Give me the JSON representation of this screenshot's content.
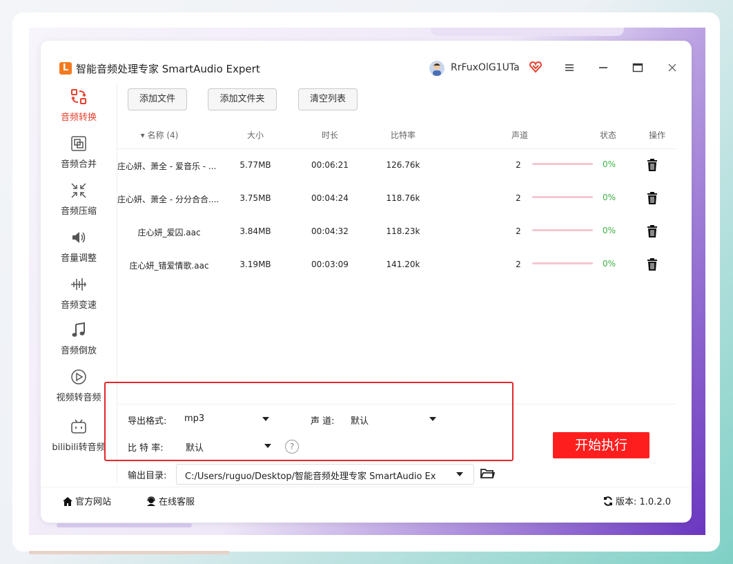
{
  "app": {
    "title": "智能音频处理专家 SmartAudio Expert",
    "logo_letter": "L"
  },
  "user": {
    "name": "RrFuxOlG1UTa"
  },
  "sidebar": {
    "items": [
      {
        "label": "音频转换",
        "icon": "convert-icon"
      },
      {
        "label": "音频合并",
        "icon": "merge-icon"
      },
      {
        "label": "音频压缩",
        "icon": "compress-icon"
      },
      {
        "label": "音量调整",
        "icon": "volume-icon"
      },
      {
        "label": "音频变速",
        "icon": "speed-icon"
      },
      {
        "label": "音频倒放",
        "icon": "reverse-icon"
      },
      {
        "label": "视频转音频",
        "icon": "video-to-audio-icon"
      },
      {
        "label": "bilibili转音频",
        "icon": "bilibili-icon"
      }
    ]
  },
  "toolbar": {
    "add_file": "添加文件",
    "add_folder": "添加文件夹",
    "clear_list": "清空列表"
  },
  "table": {
    "headers": {
      "name": "▾ 名称 (4)",
      "size": "大小",
      "duration": "时长",
      "bitrate": "比特率",
      "channel": "声道",
      "status": "状态",
      "action": "操作"
    },
    "rows": [
      {
        "name": "庄心妍、萧全 - 爱音乐 - ...",
        "size": "5.77MB",
        "duration": "00:06:21",
        "bitrate": "126.76k",
        "channel": "2",
        "progress": "0%"
      },
      {
        "name": "庄心妍、萧全 - 分分合合....",
        "size": "3.75MB",
        "duration": "00:04:24",
        "bitrate": "118.76k",
        "channel": "2",
        "progress": "0%"
      },
      {
        "name": "庄心妍_爱囚.aac",
        "size": "3.84MB",
        "duration": "00:04:32",
        "bitrate": "118.23k",
        "channel": "2",
        "progress": "0%"
      },
      {
        "name": "庄心妍_错爱情歌.aac",
        "size": "3.19MB",
        "duration": "00:03:09",
        "bitrate": "141.20k",
        "channel": "2",
        "progress": "0%"
      }
    ]
  },
  "settings": {
    "format_label": "导出格式:",
    "format_value": "mp3",
    "channel_label": "声 道:",
    "channel_value": "默认",
    "bitrate_label": "比 特 率:",
    "bitrate_value": "默认",
    "help": "?"
  },
  "start_button": "开始执行",
  "output": {
    "label": "输出目录:",
    "path": "C:/Users/ruguo/Desktop/智能音频处理专家 SmartAudio Ex"
  },
  "footer": {
    "website": "官方网站",
    "support": "在线客服",
    "version": "版本: 1.0.2.0"
  },
  "colors": {
    "accent": "#ff1e1e",
    "active_nav": "#e8412f",
    "progress_text": "#3bb043"
  }
}
